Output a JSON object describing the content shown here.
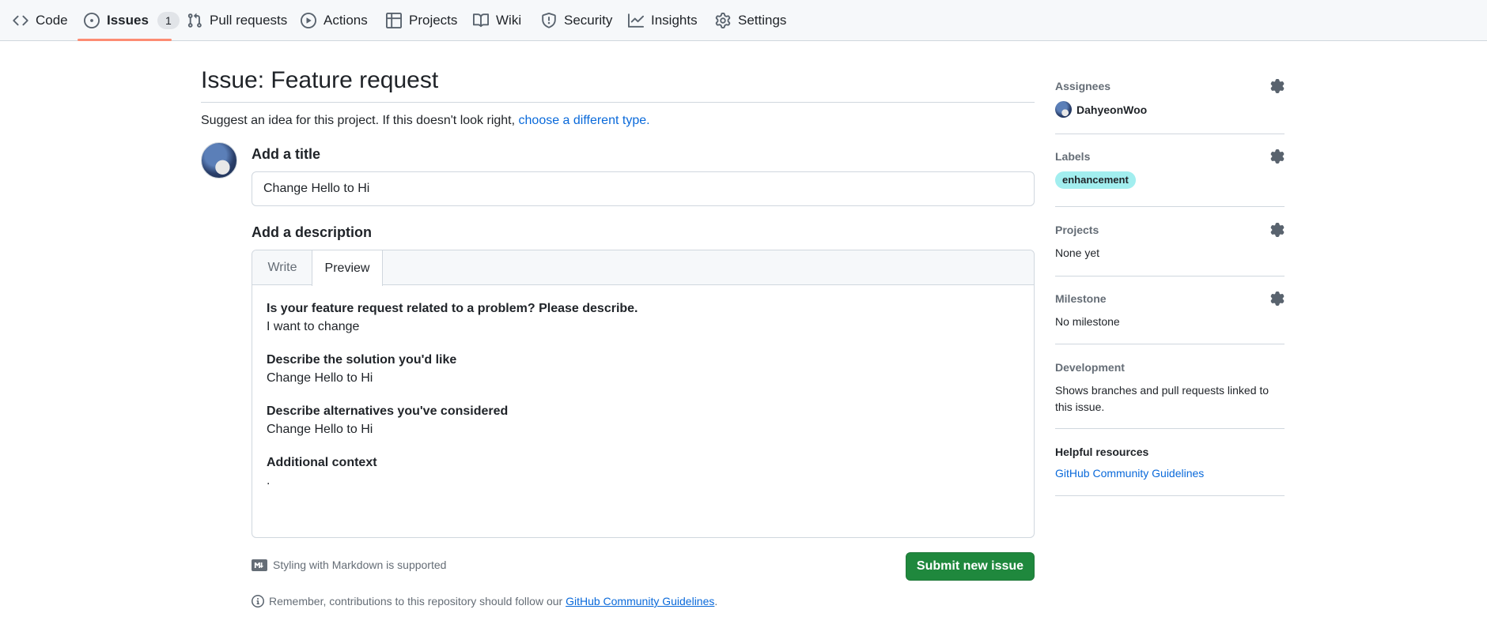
{
  "nav": {
    "items": [
      {
        "label": "Code",
        "icon": "code-icon"
      },
      {
        "label": "Issues",
        "icon": "issue-opened-icon",
        "counter": "1"
      },
      {
        "label": "Pull requests",
        "icon": "git-pull-request-icon"
      },
      {
        "label": "Actions",
        "icon": "play-icon"
      },
      {
        "label": "Projects",
        "icon": "table-icon"
      },
      {
        "label": "Wiki",
        "icon": "book-icon"
      },
      {
        "label": "Security",
        "icon": "shield-icon"
      },
      {
        "label": "Insights",
        "icon": "graph-icon"
      },
      {
        "label": "Settings",
        "icon": "gear-icon"
      }
    ],
    "selected": "Issues",
    "underline_color": "#fd8c73"
  },
  "main": {
    "title": "Issue: Feature request",
    "subtitle_text": "Suggest an idea for this project. If this doesn't look right,",
    "subtitle_link": "choose a different type.",
    "title_heading": "Add a title",
    "title_value": "Change Hello to Hi",
    "description_heading": "Add a description",
    "tabs": {
      "write": "Write",
      "preview": "Preview",
      "active": "Preview"
    },
    "preview": [
      {
        "question": "Is your feature request related to a problem? Please describe.",
        "answer": "I want to change"
      },
      {
        "question": "Describe the solution you'd like",
        "answer": "Change Hello to Hi"
      },
      {
        "question": "Describe alternatives you've considered",
        "answer": "Change Hello to Hi"
      },
      {
        "question": "Additional context",
        "answer": "."
      }
    ],
    "markdown_note": "Styling with Markdown is supported",
    "submit_label": "Submit new issue",
    "submit_color": "#1f883d",
    "remember_text": "Remember, contributions to this repository should follow our",
    "remember_link": "GitHub Community Guidelines",
    "remember_end": "."
  },
  "sidebar": {
    "assignees": {
      "heading": "Assignees",
      "user": "DahyeonWoo"
    },
    "labels": {
      "heading": "Labels",
      "label": "enhancement",
      "label_color": "#a2eeef"
    },
    "projects": {
      "heading": "Projects",
      "value": "None yet"
    },
    "milestone": {
      "heading": "Milestone",
      "value": "No milestone"
    },
    "development": {
      "heading": "Development",
      "value": "Shows branches and pull requests linked to this issue."
    },
    "helpful": {
      "heading": "Helpful resources",
      "link": "GitHub Community Guidelines"
    }
  }
}
